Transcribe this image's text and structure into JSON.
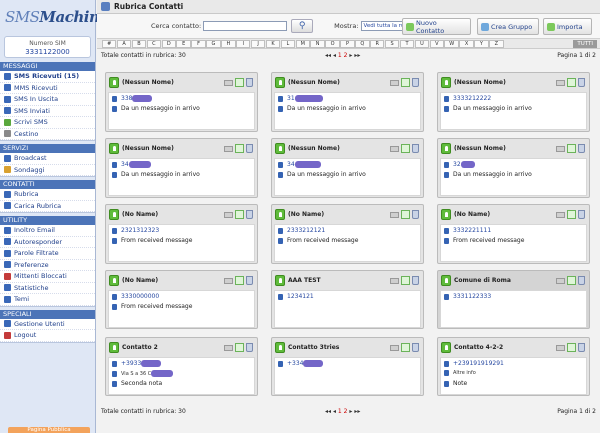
{
  "app": {
    "logo_a": "SMS",
    "logo_b": "Machine"
  },
  "sim": {
    "label": "Numero SIM",
    "number": "3331122000"
  },
  "sidebar": [
    {
      "title": "MESSAGGI",
      "items": [
        {
          "label": "SMS Ricevuti (15)",
          "bold": true,
          "icon": "inbox-icon",
          "color": "#3a68b8"
        },
        {
          "label": "MMS Ricevuti",
          "icon": "mms-icon",
          "color": "#3a68b8"
        },
        {
          "label": "SMS In Uscita",
          "icon": "outbox-icon",
          "color": "#3a68b8"
        },
        {
          "label": "SMS Inviati",
          "icon": "sent-icon",
          "color": "#3a68b8"
        },
        {
          "label": "Scrivi SMS",
          "icon": "compose-icon",
          "color": "#5aa83e"
        },
        {
          "label": "Cestino",
          "icon": "trash-icon",
          "color": "#8a8a8a"
        }
      ]
    },
    {
      "title": "SERVIZI",
      "items": [
        {
          "label": "Broadcast",
          "icon": "broadcast-icon",
          "color": "#3a68b8"
        },
        {
          "label": "Sondaggi",
          "icon": "poll-icon",
          "color": "#d9a130"
        }
      ]
    },
    {
      "title": "CONTATTI",
      "items": [
        {
          "label": "Rubrica",
          "icon": "addressbook-icon",
          "color": "#3a68b8"
        },
        {
          "label": "Carica Rubrica",
          "icon": "upload-icon",
          "color": "#3a68b8"
        }
      ]
    },
    {
      "title": "UTILITY",
      "items": [
        {
          "label": "Inoltro Email",
          "icon": "email-icon",
          "color": "#3a68b8"
        },
        {
          "label": "Autoresponder",
          "icon": "autoresponder-icon",
          "color": "#3a68b8"
        },
        {
          "label": "Parole Filtrate",
          "icon": "filter-icon",
          "color": "#3a68b8"
        },
        {
          "label": "Preferenze",
          "icon": "preferences-icon",
          "color": "#3a68b8"
        },
        {
          "label": "Mittenti Bloccati",
          "icon": "blocked-icon",
          "color": "#c43b3b"
        },
        {
          "label": "Statistiche",
          "icon": "stats-icon",
          "color": "#3a68b8"
        },
        {
          "label": "Temi",
          "icon": "themes-icon",
          "color": "#3a68b8"
        }
      ]
    },
    {
      "title": "SPECIALI",
      "items": [
        {
          "label": "Gestione Utenti",
          "icon": "users-icon",
          "color": "#3a68b8"
        },
        {
          "label": "Logout",
          "icon": "logout-icon",
          "color": "#c43b3b"
        }
      ]
    }
  ],
  "pagina_pubblica": "Pagina Pubblica",
  "header": {
    "title": "Rubrica Contatti"
  },
  "toolbar": {
    "search_label": "Cerca contatto:",
    "search_value": "",
    "mostra_label": "Mostra:",
    "mostra_value": "Vedi tutta la rubrica",
    "new_contact": "Nuovo Contatto",
    "new_group": "Crea Gruppo",
    "import": "Importa"
  },
  "alphabet": [
    "#",
    "A",
    "B",
    "C",
    "D",
    "E",
    "F",
    "G",
    "H",
    "I",
    "J",
    "K",
    "L",
    "M",
    "N",
    "O",
    "P",
    "Q",
    "R",
    "S",
    "T",
    "U",
    "V",
    "W",
    "X",
    "Y",
    "Z"
  ],
  "alphabet_all": "TUTTI",
  "pager": {
    "total": "Totale contatti in rubrica: 30",
    "first": "◂◂",
    "prev": "◂",
    "page1": "1",
    "page2": "2",
    "next": "▸",
    "last": "▸▸",
    "page_info": "Pagina 1 di 2"
  },
  "contacts": [
    {
      "name": "(Nessun Nome)",
      "phone": "338",
      "blur": 20,
      "line2": "",
      "note": "Da un messaggio in arrivo"
    },
    {
      "name": "(Nessun Nome)",
      "phone": "31",
      "blur": 28,
      "line2": "",
      "note": "Da un messaggio in arrivo"
    },
    {
      "name": "(Nessun Nome)",
      "phone": "3333212222",
      "blur": 0,
      "line2": "",
      "note": "Da un messaggio in arrivo"
    },
    {
      "name": "(Nessun Nome)",
      "phone": "34",
      "blur": 22,
      "line2": "",
      "note": "Da un messaggio in arrivo"
    },
    {
      "name": "(Nessun Nome)",
      "phone": "34",
      "blur": 26,
      "line2": "",
      "note": "Da un messaggio in arrivo"
    },
    {
      "name": "(Nessun Nome)",
      "phone": "32",
      "blur": 14,
      "line2": "",
      "note": "Da un messaggio in arrivo"
    },
    {
      "name": "(No Name)",
      "phone": "2321312323",
      "blur": 0,
      "line2": "",
      "note": "From received message"
    },
    {
      "name": "(No Name)",
      "phone": "2333212121",
      "blur": 0,
      "line2": "",
      "note": "From received message"
    },
    {
      "name": "(No Name)",
      "phone": "3332221111",
      "blur": 0,
      "line2": "",
      "note": "From received message"
    },
    {
      "name": "(No Name)",
      "phone": "3330000000",
      "blur": 0,
      "line2": "",
      "note": "From received message"
    },
    {
      "name": "AAA TEST",
      "phone": "1234121",
      "blur": 0,
      "line2": "",
      "note": ""
    },
    {
      "name": "Comune di Roma",
      "phone": "3331122333",
      "blur": 0,
      "line2": "",
      "note": ""
    },
    {
      "name": "Contatto 2",
      "phone": "+3933",
      "blur": 20,
      "line2": "Via S  a 36 C",
      "note": "Seconda nota"
    },
    {
      "name": "Contatto 3tries",
      "phone": "+334",
      "blur": 20,
      "line2": "",
      "note": ""
    },
    {
      "name": "Contatto 4-2-2",
      "phone": "+239191919291",
      "blur": 0,
      "line2": "Altre info",
      "note": "Note"
    }
  ],
  "colors": {
    "brand_blue": "#4c74b8",
    "accent_green": "#5fbb3b",
    "page_orange": "#f3a35c"
  }
}
